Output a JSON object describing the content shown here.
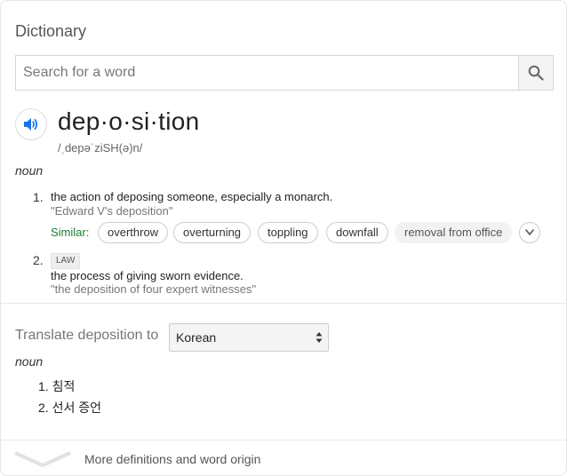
{
  "card": {
    "title": "Dictionary",
    "search": {
      "placeholder": "Search for a word",
      "button_icon": "search-icon"
    }
  },
  "entry": {
    "headword": "dep·o·si·tion",
    "phonetic": "/ˌdepəˈziSH(ə)n/",
    "speaker_icon": "speaker-icon",
    "part_of_speech": "noun",
    "senses": [
      {
        "number": "1.",
        "definition": "the action of deposing someone, especially a monarch.",
        "example": "\"Edward V's deposition\"",
        "similar_label": "Similar:",
        "similar": [
          "overthrow",
          "overturning",
          "toppling",
          "downfall",
          "removal from office"
        ]
      },
      {
        "number": "2.",
        "label": "LAW",
        "definition": "the process of giving sworn evidence.",
        "example": "\"the deposition of four expert witnesses\""
      }
    ]
  },
  "translate": {
    "label": "Translate deposition to",
    "selected_language": "Korean",
    "part_of_speech": "noun",
    "items": [
      {
        "number": "1.",
        "text": "침적"
      },
      {
        "number": "2.",
        "text": "선서 증언"
      }
    ]
  },
  "footer": {
    "more_label": "More definitions and word origin"
  },
  "colors": {
    "similar_label": "#1a7e34",
    "speaker_blue": "#1a73e8"
  }
}
